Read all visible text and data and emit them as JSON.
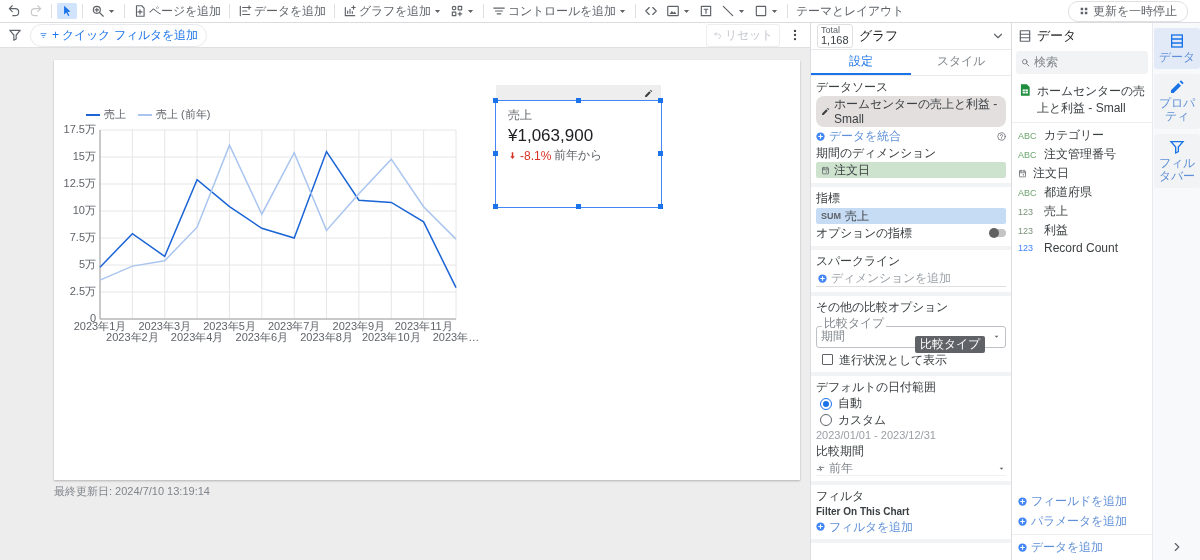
{
  "toolbar": {
    "undo_disabled": false,
    "redo_disabled": true,
    "pointer_selected": true,
    "buttons": [
      {
        "label": "ページを追加",
        "caret": false
      },
      {
        "label": "データを追加",
        "caret": false
      },
      {
        "label": "グラフを追加",
        "caret": true
      },
      {
        "label": "コントロールを追加",
        "caret": true
      },
      {
        "label": "テーマとレイアウト",
        "caret": false
      }
    ],
    "pause_button": "更新を一時停止"
  },
  "filter_bar": {
    "quick_filter": "+ クイック フィルタを追加",
    "reset": "リセット",
    "reset_disabled": true
  },
  "report": {
    "chart": {
      "chart_data": {
        "type": "line",
        "categories": [
          "2023年1月",
          "2023年2月",
          "2023年3月",
          "2023年4月",
          "2023年5月",
          "2023年6月",
          "2023年7月",
          "2023年8月",
          "2023年9月",
          "2023年10月",
          "2023年11月",
          "2023年…"
        ],
        "series": [
          {
            "name": "売上",
            "color": "#1a64d6",
            "values": [
              4.8,
              7.9,
              5.8,
              12.9,
              10.4,
              8.4,
              7.5,
              15.5,
              11.0,
              10.8,
              9.0,
              2.9
            ]
          },
          {
            "name": "売上 (前年)",
            "color": "#a9c5ef",
            "values": [
              3.6,
              4.9,
              5.4,
              8.5,
              16.1,
              9.7,
              15.4,
              8.2,
              11.6,
              14.8,
              10.4,
              7.4
            ]
          }
        ],
        "ylim": [
          0,
          17.5
        ],
        "grid": true,
        "legend": true,
        "yticks": [
          {
            "value": 0,
            "label": "0"
          },
          {
            "value": 2.5,
            "label": "2.5万"
          },
          {
            "value": 5,
            "label": "5万"
          },
          {
            "value": 7.5,
            "label": "7.5万"
          },
          {
            "value": 10,
            "label": "10万"
          },
          {
            "value": 12.5,
            "label": "12.5万"
          },
          {
            "value": 15,
            "label": "15万"
          },
          {
            "value": 17.5,
            "label": "17.5万"
          }
        ]
      }
    },
    "scorecard": {
      "label": "売上",
      "value": "¥1,063,900",
      "delta": "-8.1%",
      "negative": true,
      "delta_suffix": "前年から",
      "selected": true
    },
    "last_updated": "最終更新日: 2024/7/10 13:19:14"
  },
  "properties": {
    "total_label": "Total",
    "total": "1,168",
    "title": "グラフ",
    "tabs": [
      {
        "label": "設定",
        "selected": true
      },
      {
        "label": "スタイル",
        "selected": false
      }
    ],
    "data_source": {
      "heading": "データソース",
      "name": "ホームセンターの売上と利益 - Small",
      "blend": "データを統合"
    },
    "date_dimension": {
      "heading": "期間のディメンション",
      "field": "注文日"
    },
    "metric": {
      "heading": "指標",
      "aggregation": "SUM",
      "field": "売上"
    },
    "optional_metrics": {
      "label": "オプションの指標",
      "on": false
    },
    "sparkline": {
      "heading": "スパークライン",
      "placeholder": "ディメンションを追加"
    },
    "comparison": {
      "heading": "その他の比較オプション",
      "field_label": "比較タイプ",
      "value": "期間",
      "tooltip": "比較タイプ",
      "progress": {
        "label": "進行状況として表示",
        "checked": false
      }
    },
    "date_range": {
      "heading": "デフォルトの日付範囲",
      "options": [
        {
          "label": "自動",
          "selected": true
        },
        {
          "label": "カスタム",
          "selected": false
        }
      ],
      "range": "2023/01/01 - 2023/12/31",
      "compare_label": "比較期間",
      "compare_value": "前年"
    },
    "filter": {
      "heading": "フィルタ",
      "subheading": "Filter On This Chart",
      "add": "フィルタを追加"
    }
  },
  "data_panel": {
    "title": "データ",
    "search_placeholder": "検索",
    "source": "ホームセンターの売上と利益 - Small",
    "fields": [
      {
        "kind": "dimension",
        "badge": "ABC",
        "name": "カテゴリー"
      },
      {
        "kind": "dimension",
        "badge": "ABC",
        "name": "注文管理番号"
      },
      {
        "kind": "date",
        "name": "注文日"
      },
      {
        "kind": "dimension",
        "badge": "ABC",
        "name": "都道府県"
      },
      {
        "kind": "metric",
        "badge": "123",
        "name": "売上"
      },
      {
        "kind": "metric",
        "badge": "123",
        "name": "利益"
      },
      {
        "kind": "count",
        "badge": "123",
        "name": "Record Count"
      }
    ],
    "add_field": "フィールドを追加",
    "add_parameter": "パラメータを追加",
    "add_data": "データを追加"
  },
  "side_tabs": [
    {
      "label": "データ",
      "selected": true
    },
    {
      "label": "プロパティ",
      "selected": false
    },
    {
      "label": "フィルタバー",
      "selected": false
    }
  ]
}
